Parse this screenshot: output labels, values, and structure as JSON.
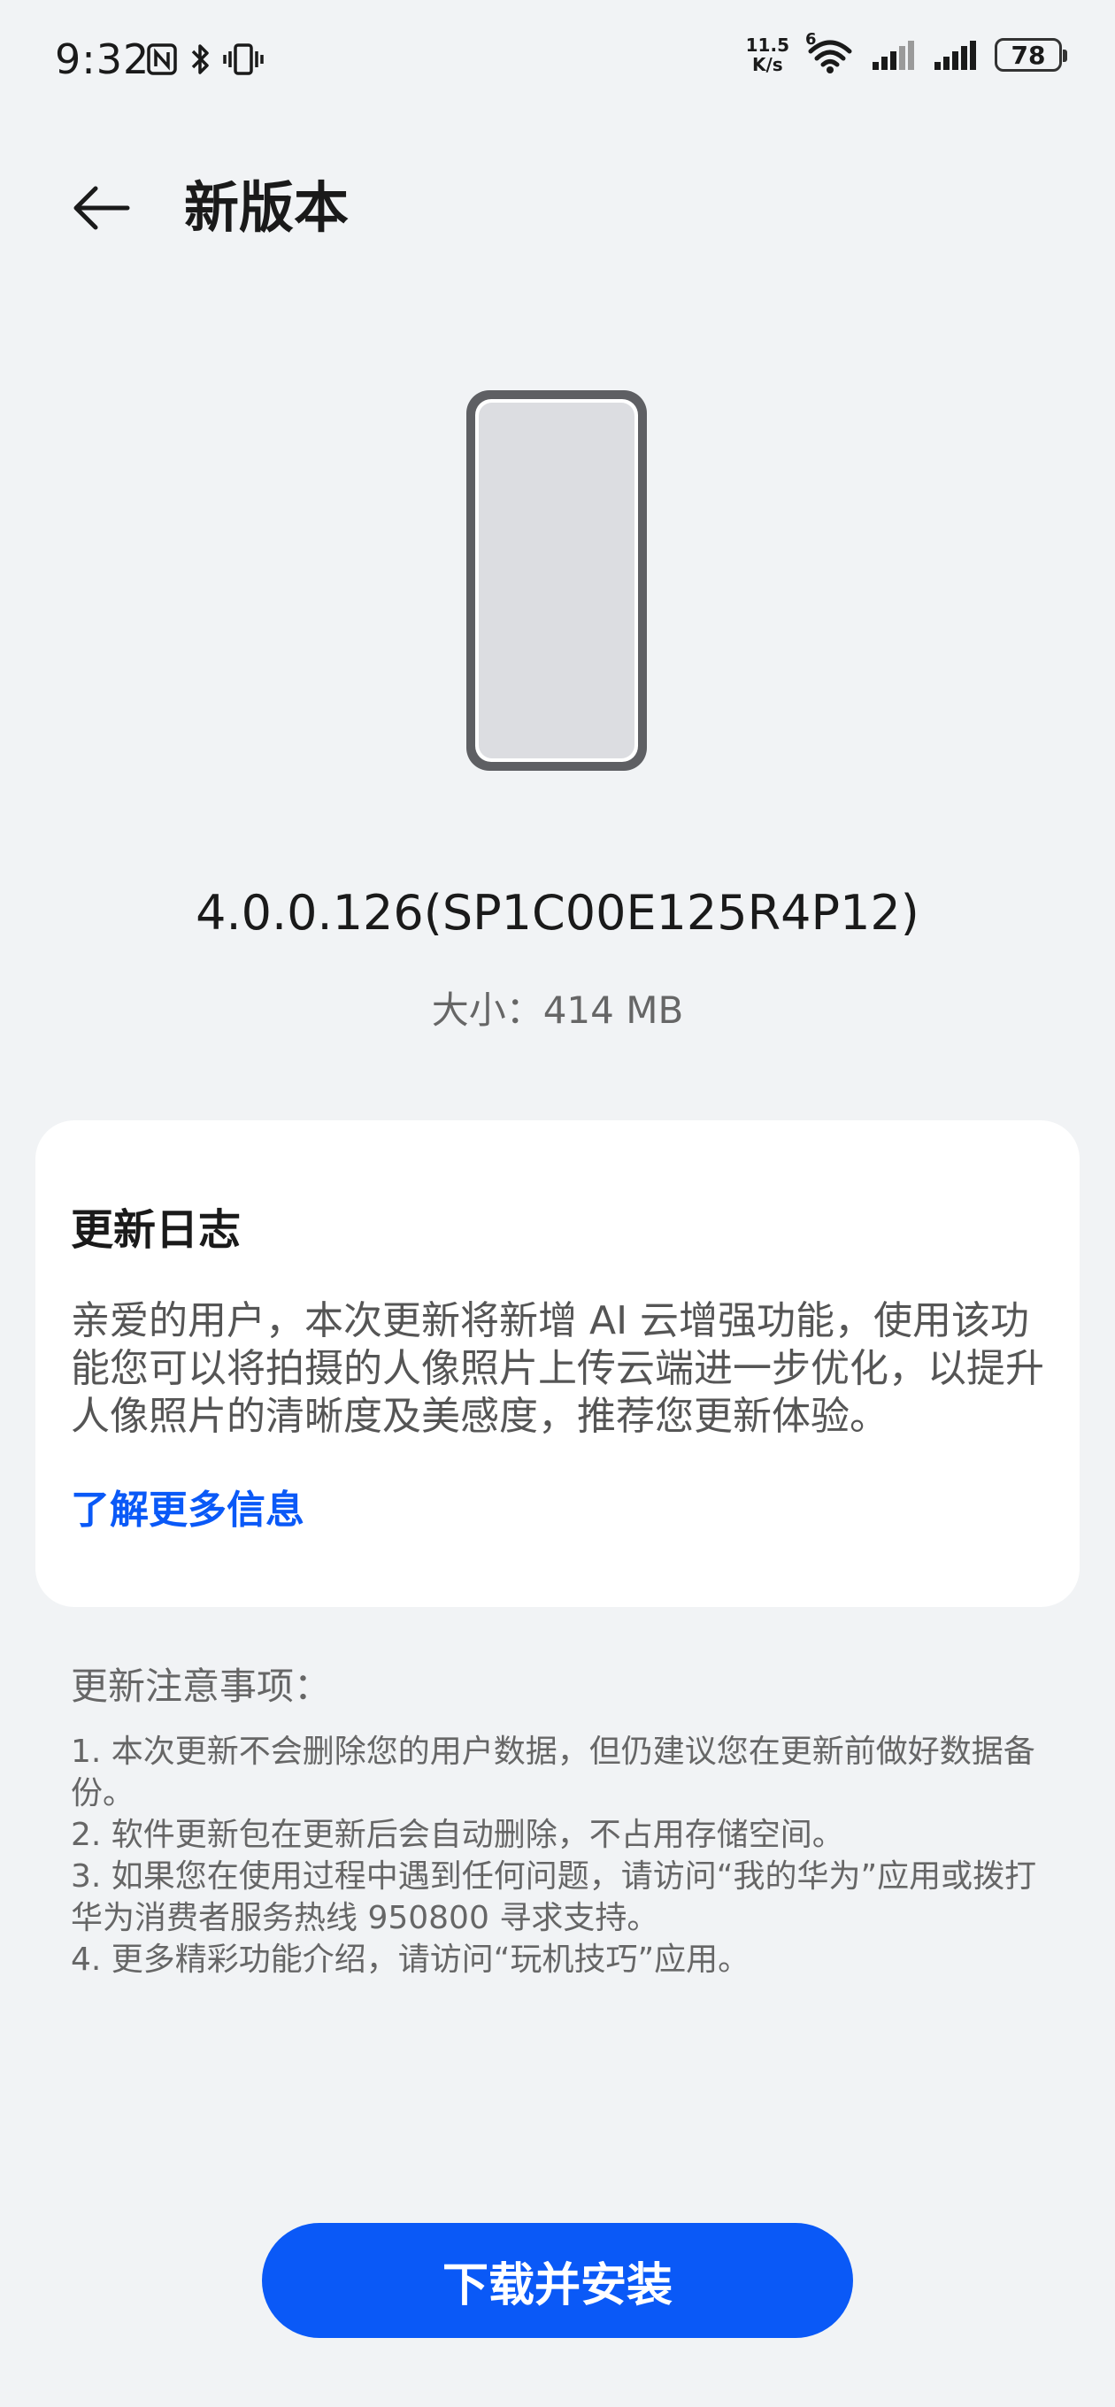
{
  "status_bar": {
    "time": "9:32",
    "net_speed_value": "11.5",
    "net_speed_unit": "K/s",
    "wifi_badge": "6",
    "battery": "78",
    "icons": [
      "nfc-icon",
      "bluetooth-icon",
      "vibrate-icon",
      "wifi-icon",
      "signal-icon",
      "signal-icon",
      "battery-icon"
    ]
  },
  "header": {
    "back_icon": "arrow-left-icon",
    "title": "新版本"
  },
  "update": {
    "version": "4.0.0.126(SP1C00E125R4P12)",
    "size": "大小：414 MB"
  },
  "changelog": {
    "title": "更新日志",
    "body": "亲爱的用户，本次更新将新增 AI 云增强功能，使用该功能您可以将拍摄的人像照片上传云端进一步优化，以提升人像照片的清晰度及美感度，推荐您更新体验。",
    "link": "了解更多信息"
  },
  "notes": {
    "title": "更新注意事项：",
    "items": [
      "1. 本次更新不会删除您的用户数据，但仍建议您在更新前做好数据备份。",
      "2. 软件更新包在更新后会自动删除，不占用存储空间。",
      "3. 如果您在使用过程中遇到任何问题，请访问“我的华为”应用或拨打华为消费者服务热线 950800 寻求支持。",
      "4. 更多精彩功能介绍，请访问“玩机技巧”应用。"
    ]
  },
  "actions": {
    "download_install": "下载并安装"
  },
  "colors": {
    "background": "#f1f3f5",
    "accent": "#0a59f7",
    "card": "#ffffff"
  }
}
